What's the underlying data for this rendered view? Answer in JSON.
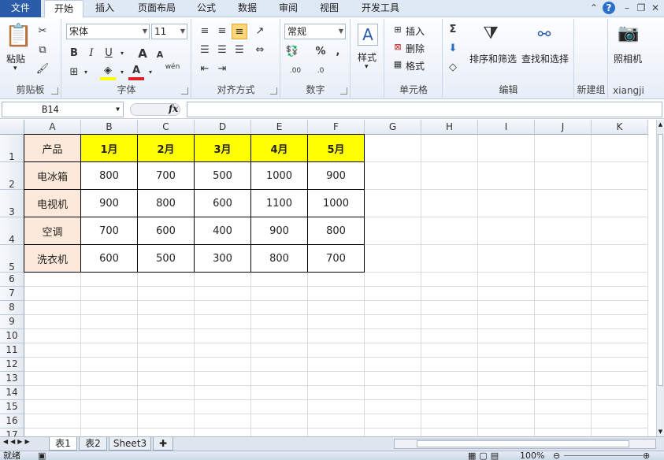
{
  "tabs": {
    "file": "文件",
    "items": [
      "开始",
      "插入",
      "页面布局",
      "公式",
      "数据",
      "审阅",
      "视图",
      "开发工具"
    ],
    "active": 0
  },
  "ribbon": {
    "clipboard": {
      "label": "剪贴板",
      "paste": "粘贴"
    },
    "font": {
      "label": "字体",
      "name": "宋体",
      "size": "11",
      "bold": "B",
      "italic": "I",
      "underline": "U",
      "grow": "A",
      "shrink": "A",
      "pinyin": "wén"
    },
    "alignment": {
      "label": "对齐方式"
    },
    "number": {
      "label": "数字",
      "format": "常规",
      "percent": "%",
      "comma": ",",
      "inc_decimal": ".00",
      "dec_decimal": ".0"
    },
    "styles": {
      "label": "样式"
    },
    "cells": {
      "label": "单元格",
      "insert": "插入",
      "delete": "删除",
      "format": "格式"
    },
    "editing": {
      "label": "编辑",
      "sort": "排序和筛选",
      "find": "查找和选择",
      "sigma": "Σ"
    },
    "newgroup": {
      "label": "新建组"
    },
    "xiangji": {
      "label": "xiangji",
      "camera": "照相机"
    }
  },
  "formula_bar": {
    "name_box": "B14",
    "fx": "fx",
    "value": ""
  },
  "columns": [
    "A",
    "B",
    "C",
    "D",
    "E",
    "F",
    "G",
    "H",
    "I",
    "J",
    "K"
  ],
  "rows": [
    "1",
    "2",
    "3",
    "4",
    "5",
    "6",
    "7",
    "8",
    "9",
    "10",
    "11",
    "12",
    "13",
    "14",
    "15",
    "16",
    "17"
  ],
  "table": {
    "header": [
      "产品",
      "1月",
      "2月",
      "3月",
      "4月",
      "5月"
    ],
    "rows": [
      [
        "电冰箱",
        "800",
        "700",
        "500",
        "1000",
        "900"
      ],
      [
        "电视机",
        "900",
        "800",
        "600",
        "1100",
        "1000"
      ],
      [
        "空调",
        "700",
        "600",
        "400",
        "900",
        "800"
      ],
      [
        "洗衣机",
        "600",
        "500",
        "300",
        "800",
        "700"
      ]
    ]
  },
  "sheets": [
    "表1",
    "表2",
    "Sheet3"
  ],
  "active_sheet": 0,
  "status": {
    "ready": "就绪",
    "zoom": "100%"
  },
  "colors": {
    "header_fill": "#ffff00",
    "product_fill": "#fde9d9",
    "file_tab": "#2a5caa"
  }
}
